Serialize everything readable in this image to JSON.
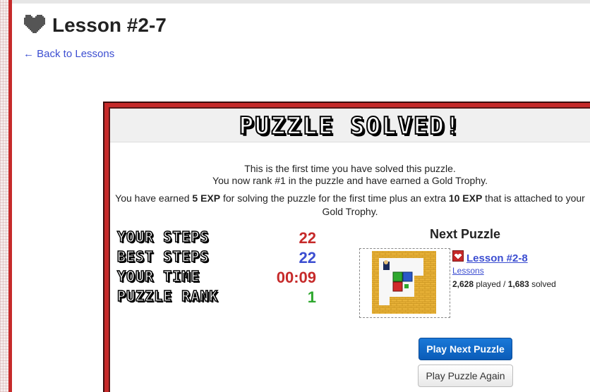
{
  "page": {
    "title": "Lesson #2-7",
    "back_link": "← Back to Lessons"
  },
  "result": {
    "banner": "PUZZLE SOLVED!",
    "line1": "This is the first time you have solved this puzzle.",
    "line2": "You now rank #1 in the puzzle and have earned a Gold Trophy.",
    "exp_prefix": "You have earned ",
    "exp_amount": "5 EXP",
    "exp_middle": " for solving the puzzle for the first time plus an extra ",
    "exp_extra": "10 EXP",
    "exp_suffix": " that is attached to your Gold Trophy."
  },
  "stats": [
    {
      "label": "YOUR STEPS",
      "value": "22",
      "color": "#c62a2a"
    },
    {
      "label": "BEST STEPS",
      "value": "22",
      "color": "#3c4ed1"
    },
    {
      "label": "YOUR TIME",
      "value": "00:09",
      "color": "#c62a2a"
    },
    {
      "label": "PUZZLE RANK",
      "value": "1",
      "color": "#2ea82e"
    }
  ],
  "next_puzzle": {
    "heading": "Next Puzzle",
    "name": "Lesson #2-8",
    "category": "Lessons",
    "played": "2,628",
    "played_label": " played / ",
    "solved": "1,683",
    "solved_label": " solved"
  },
  "buttons": {
    "play_next": "Play Next Puzzle",
    "play_again": "Play Puzzle Again"
  },
  "colors": {
    "accent_red": "#c62a2a",
    "link_blue": "#3c4ed1",
    "primary_button": "#0a5cb8"
  }
}
